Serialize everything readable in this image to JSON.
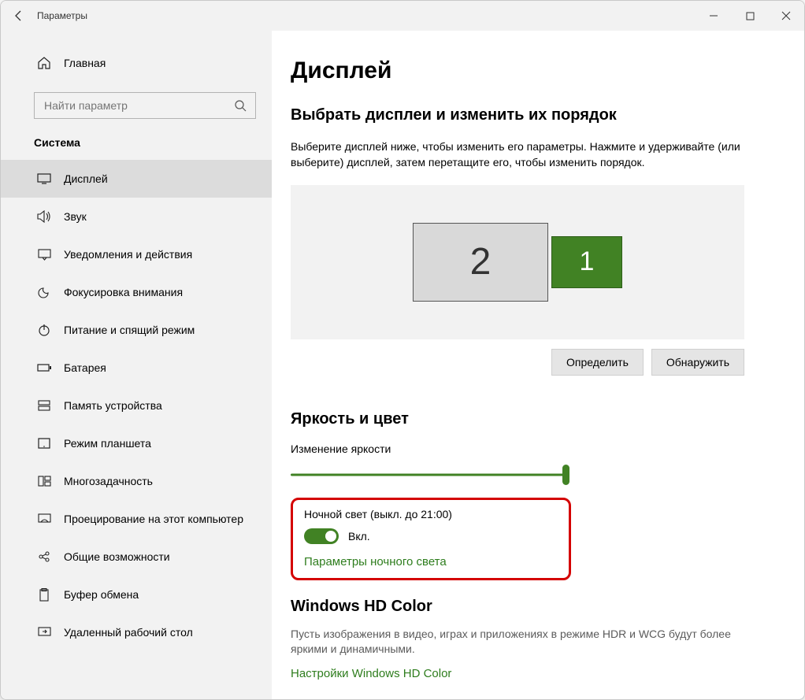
{
  "titlebar": {
    "title": "Параметры"
  },
  "sidebar": {
    "home": "Главная",
    "search_placeholder": "Найти параметр",
    "group": "Система",
    "items": [
      {
        "label": "Дисплей"
      },
      {
        "label": "Звук"
      },
      {
        "label": "Уведомления и действия"
      },
      {
        "label": "Фокусировка внимания"
      },
      {
        "label": "Питание и спящий режим"
      },
      {
        "label": "Батарея"
      },
      {
        "label": "Память устройства"
      },
      {
        "label": "Режим планшета"
      },
      {
        "label": "Многозадачность"
      },
      {
        "label": "Проецирование на этот компьютер"
      },
      {
        "label": "Общие возможности"
      },
      {
        "label": "Буфер обмена"
      },
      {
        "label": "Удаленный рабочий стол"
      }
    ]
  },
  "main": {
    "page_title": "Дисплей",
    "arrange_title": "Выбрать дисплеи и изменить их порядок",
    "arrange_helper": "Выберите дисплей ниже, чтобы изменить его параметры. Нажмите и удерживайте (или выберите) дисплей, затем перетащите его, чтобы изменить порядок.",
    "monitor2": "2",
    "monitor1": "1",
    "identify_btn": "Определить",
    "detect_btn": "Обнаружить",
    "brightness_title": "Яркость и цвет",
    "brightness_label": "Изменение яркости",
    "nightlight_label": "Ночной свет (выкл. до 21:00)",
    "toggle_state": "Вкл.",
    "nightlight_link": "Параметры ночного света",
    "hd_title": "Windows HD Color",
    "hd_desc": "Пусть изображения в видео, играх и приложениях в режиме HDR и WCG будут более яркими и динамичными.",
    "hd_link": "Настройки Windows HD Color"
  }
}
